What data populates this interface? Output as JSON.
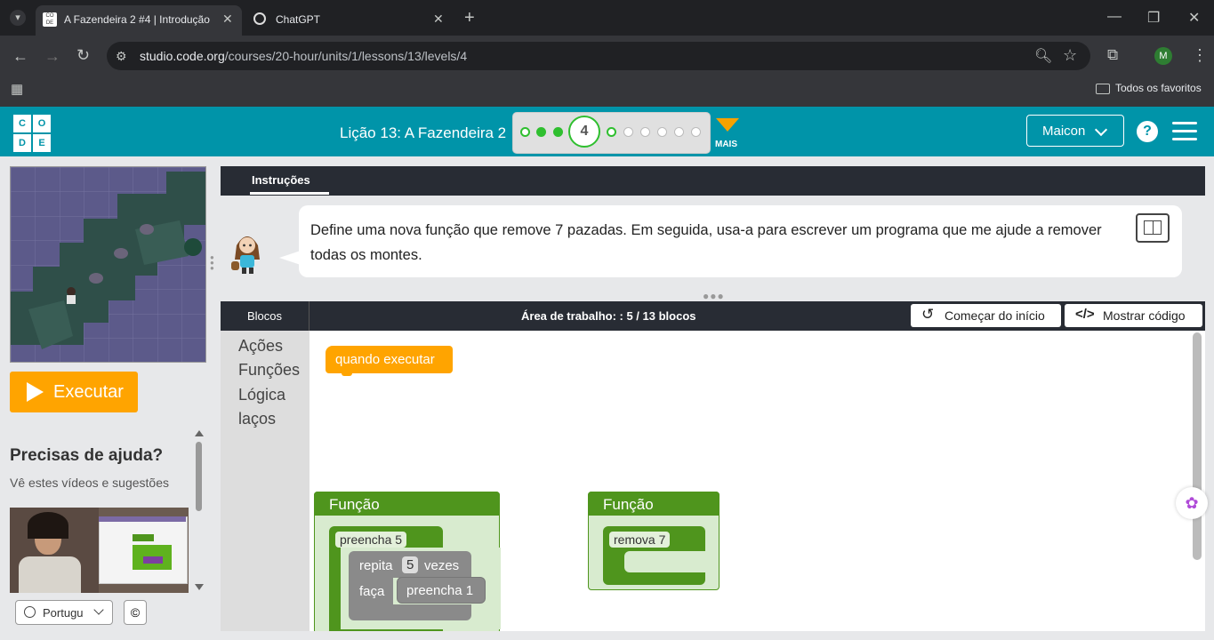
{
  "browser": {
    "tabs": [
      {
        "title": "A Fazendeira 2 #4 | Introdução",
        "active": true
      },
      {
        "title": "ChatGPT",
        "active": false
      }
    ],
    "url_host": "studio.code.org",
    "url_path": "/courses/20-hour/units/1/lessons/13/levels/4",
    "bookmarks_label": "Todos os favoritos",
    "profile_initial": "M"
  },
  "header": {
    "logo_letters": [
      "C",
      "O",
      "D",
      "E"
    ],
    "lesson_title": "Lição 13: A Fazendeira 2",
    "current_level": "4",
    "more_label": "MAIS",
    "user_name": "Maicon",
    "help_label": "?"
  },
  "left": {
    "run_label": "Executar",
    "help_title": "Precisas de ajuda?",
    "help_sub": "Vê estes vídeos e sugestões",
    "language": "Portugu",
    "copyright_icon": "©"
  },
  "instructions": {
    "tab_label": "Instruções",
    "text": "Define uma nova função que remove 7 pazadas. Em seguida, usa-a para escrever um programa que me ajude a remover todas os montes."
  },
  "workspace": {
    "toolbox_header": "Blocos",
    "title": "Área de trabalho: : 5 / 13 blocos",
    "reset_label": "Começar do início",
    "show_code_label": "Mostrar código",
    "categories": [
      "Ações",
      "Funções",
      "Lógica",
      "laços"
    ],
    "when_run_label": "quando executar",
    "func1": {
      "header": "Função",
      "name": "preencha 5",
      "repeat_label": "repita",
      "repeat_count": "5",
      "times_label": "vezes",
      "do_label": "faça",
      "inner_call": "preencha 1"
    },
    "func2": {
      "header": "Função",
      "name": "remova 7"
    }
  },
  "colors": {
    "codeorg_teal": "#0094a9",
    "run_orange": "#ffa400",
    "event_block": "#ffa400",
    "function_green": "#4f951d",
    "loop_gray": "#8a8a8a",
    "progress_green": "#2fbf2f"
  }
}
